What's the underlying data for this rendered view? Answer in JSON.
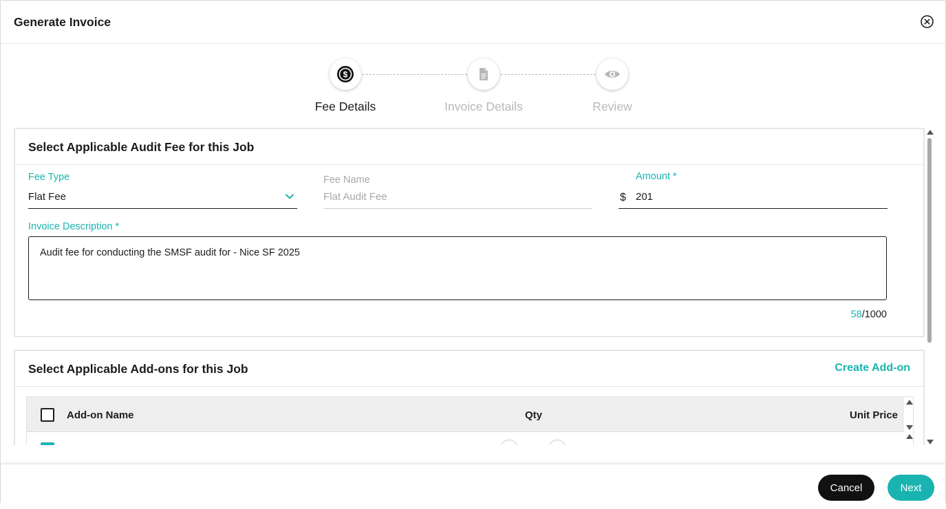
{
  "dialog": {
    "title": "Generate Invoice"
  },
  "stepper": {
    "steps": [
      {
        "label": "Fee Details",
        "icon": "dollar-coin-icon",
        "active": true
      },
      {
        "label": "Invoice Details",
        "icon": "document-icon",
        "active": false
      },
      {
        "label": "Review",
        "icon": "eye-icon",
        "active": false
      }
    ]
  },
  "fee_section": {
    "title": "Select Applicable Audit Fee for this Job",
    "fee_type": {
      "label": "Fee Type",
      "value": "Flat Fee"
    },
    "fee_name": {
      "label": "Fee Name",
      "value": "Flat Audit Fee"
    },
    "amount": {
      "label": "Amount *",
      "currency": "$",
      "value": "201"
    },
    "description": {
      "label": "Invoice Description *",
      "value": "Audit fee for conducting the SMSF audit for - Nice SF 2025",
      "count": "58",
      "max": "/1000"
    }
  },
  "addons_section": {
    "title": "Select Applicable Add-ons for this Job",
    "create_label": "Create Add-on",
    "columns": [
      "Add-on Name",
      "Qty",
      "Unit Price"
    ]
  },
  "footer": {
    "cancel_label": "Cancel",
    "next_label": "Next"
  },
  "colors": {
    "accent": "#1ab4b0",
    "dark": "#111111",
    "muted": "#b8b8b8"
  }
}
